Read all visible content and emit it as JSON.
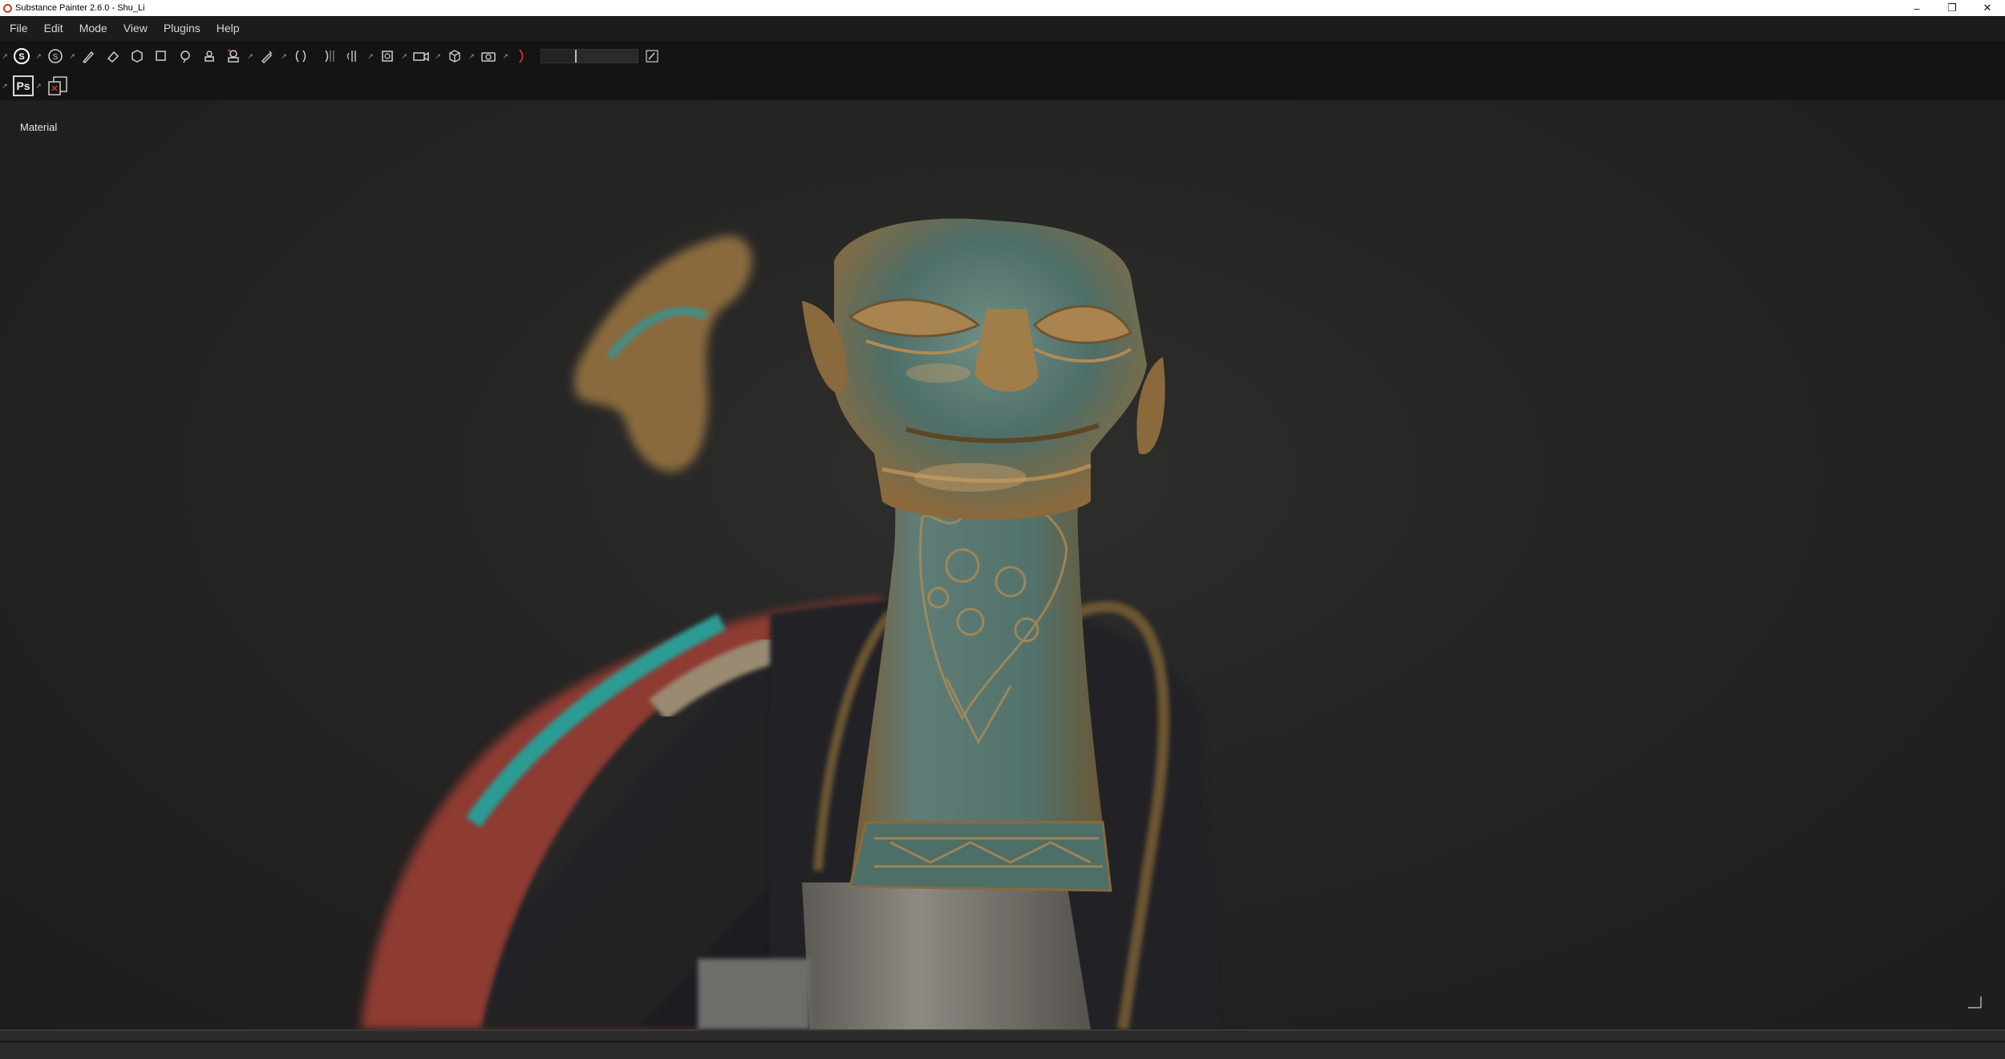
{
  "window": {
    "title": "Substance Painter 2.6.0 - Shu_Li",
    "controls": [
      "minimize",
      "restore",
      "close"
    ]
  },
  "menu": {
    "items": [
      "File",
      "Edit",
      "Mode",
      "View",
      "Plugins",
      "Help"
    ]
  },
  "toolbar": {
    "tools": [
      "substance-logo-icon",
      "substance-circle-icon",
      "paint-brush-icon",
      "eraser-icon",
      "projection-icon",
      "polygon-fill-icon",
      "smudge-icon",
      "clone-icon",
      "material-picker-icon",
      "color-picker-icon",
      "symmetry-icon",
      "mirror-icon",
      "camera-icon",
      "display-settings-icon",
      "screenshot-icon"
    ],
    "brush_size_value": "8"
  },
  "toolbar2": {
    "photoshop_label": "Ps"
  },
  "viewport": {
    "channel_label": "Material"
  },
  "colors": {
    "accent": "#c0392b",
    "bronze": "#8a6a3d",
    "patina": "#4f7f78",
    "red_cloth": "#8e3a32",
    "teal_cloth": "#2c9c94"
  }
}
